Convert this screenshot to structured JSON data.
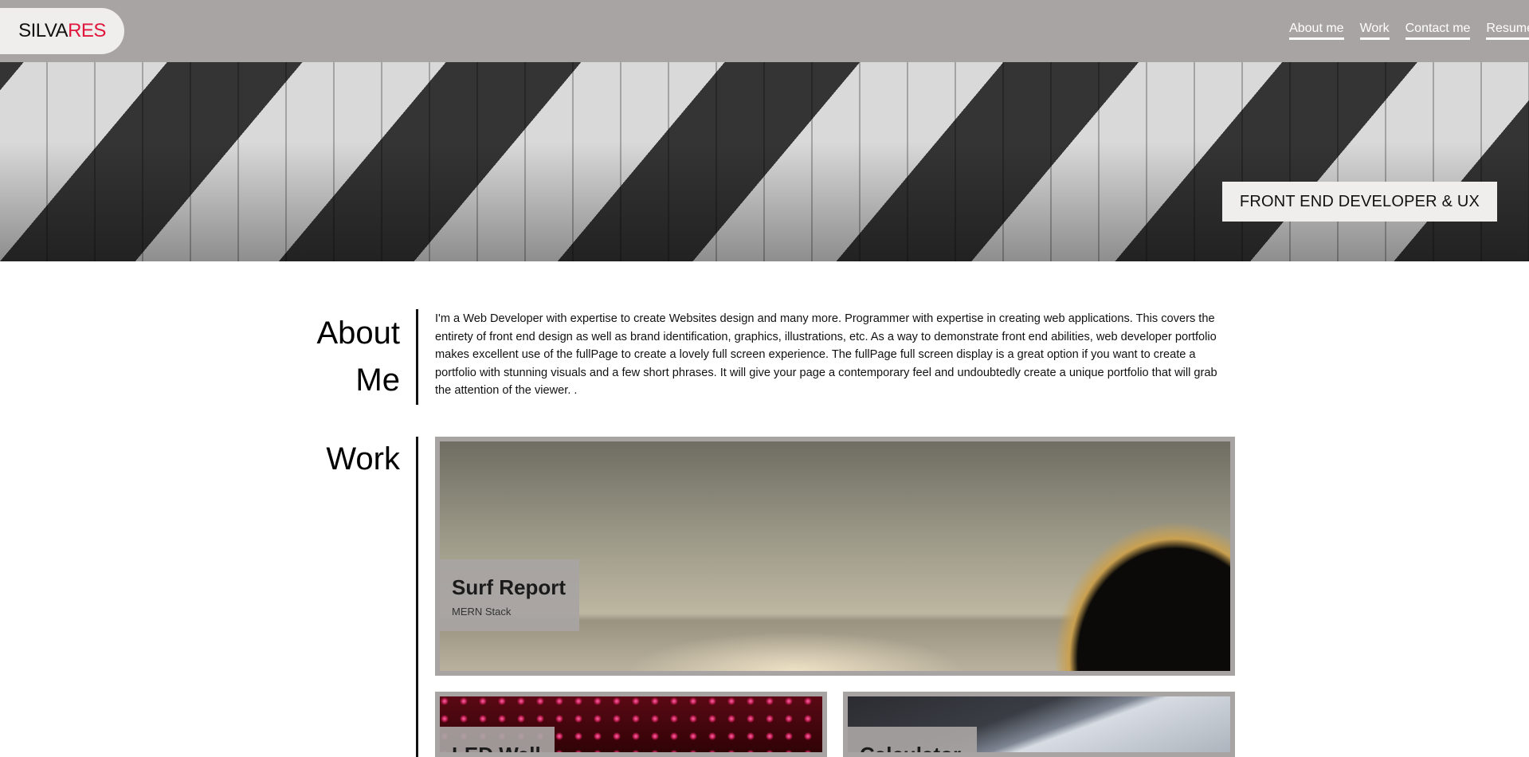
{
  "logo": {
    "part1": "SILVA",
    "part2": "RES"
  },
  "nav": {
    "items": [
      {
        "label": "About me"
      },
      {
        "label": "Work"
      },
      {
        "label": "Contact me"
      },
      {
        "label": "Resume"
      }
    ]
  },
  "hero": {
    "tagline": "FRONT END DEVELOPER & UX"
  },
  "about": {
    "title_line1": "About",
    "title_line2": "Me",
    "text": "I'm a Web Developer with expertise to create Websites design and many more. Programmer with expertise in creating web applications. This covers the entirety of front end design as well as brand identification, graphics, illustrations, etc. As a way to demonstrate front end abilities, web developer portfolio makes excellent use of the fullPage to create a lovely full screen experience. The fullPage full screen display is a great option if you want to create a portfolio with stunning visuals and a few short phrases. It will give your page a contemporary feel and undoubtedly create a unique portfolio that will grab the attention of the viewer. ."
  },
  "work": {
    "title": "Work",
    "projects": [
      {
        "title": "Surf Report",
        "subtitle": "MERN Stack"
      },
      {
        "title": "LED Wall"
      },
      {
        "title": "Calculator"
      }
    ]
  },
  "colors": {
    "header_bg": "#a8a4a3",
    "logo_accent": "#e0163c",
    "badge_bg": "#efeeed"
  }
}
